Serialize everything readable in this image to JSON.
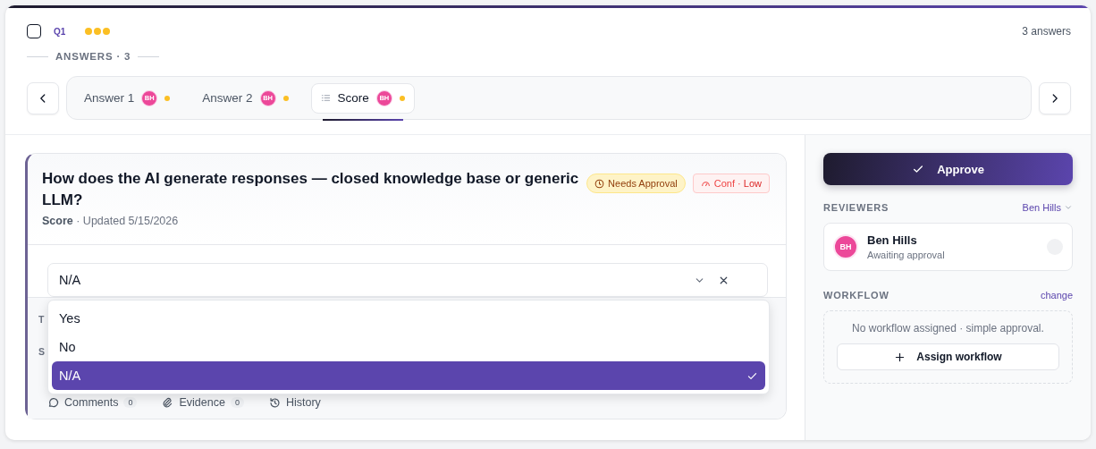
{
  "question": {
    "checked": false,
    "id": "Q1",
    "dots": [
      {
        "color": "#fbbf24"
      },
      {
        "color": "#fbbf24"
      },
      {
        "color": "#fbbf24"
      }
    ],
    "answer_count": "3 answers"
  },
  "answers_label": "ANSWERS · 3",
  "tabs": [
    {
      "kind": "answer",
      "label": "Answer 1",
      "avatar": "BH",
      "color": "#fbbf24",
      "selected": false
    },
    {
      "kind": "answer",
      "label": "Answer 2",
      "avatar": "BH",
      "color": "#fbbf24",
      "selected": false
    },
    {
      "kind": "score",
      "label": "Score",
      "avatar": "BH",
      "color": "#fbbf24",
      "selected": true
    }
  ],
  "card": {
    "title": "How does the AI generate responses — closed knowledge base or generic LLM?",
    "meta": "**Score** · Updated 5/15/2026",
    "badges": [
      {
        "kind": "status",
        "text": "Needs Approval"
      },
      {
        "kind": "confidence",
        "label": "Conf ·",
        "value": "Low"
      }
    ],
    "select": {
      "value": "N/A",
      "options": [
        {
          "label": "Yes",
          "selected": false
        },
        {
          "label": "No",
          "selected": false
        },
        {
          "label": "N/A",
          "selected": true
        }
      ]
    },
    "hidden_labels": [
      "T",
      "S"
    ],
    "footer_tabs": [
      {
        "kind": "comments",
        "label": "Comments",
        "count": "0"
      },
      {
        "kind": "evidence",
        "label": "Evidence",
        "count": "0"
      },
      {
        "kind": "history",
        "label": "History"
      }
    ]
  },
  "sidebar": {
    "approve": "Approve",
    "reviewers_label": "REVIEWERS",
    "reviewer_filter": "Ben Hills",
    "reviewers": [
      {
        "initials": "BH",
        "name": "Ben Hills",
        "status": "Awaiting approval"
      }
    ],
    "workflow_label": "WORKFLOW",
    "workflow_change": "change",
    "workflow_empty": "No workflow assigned · simple approval.",
    "assign": "Assign workflow"
  }
}
